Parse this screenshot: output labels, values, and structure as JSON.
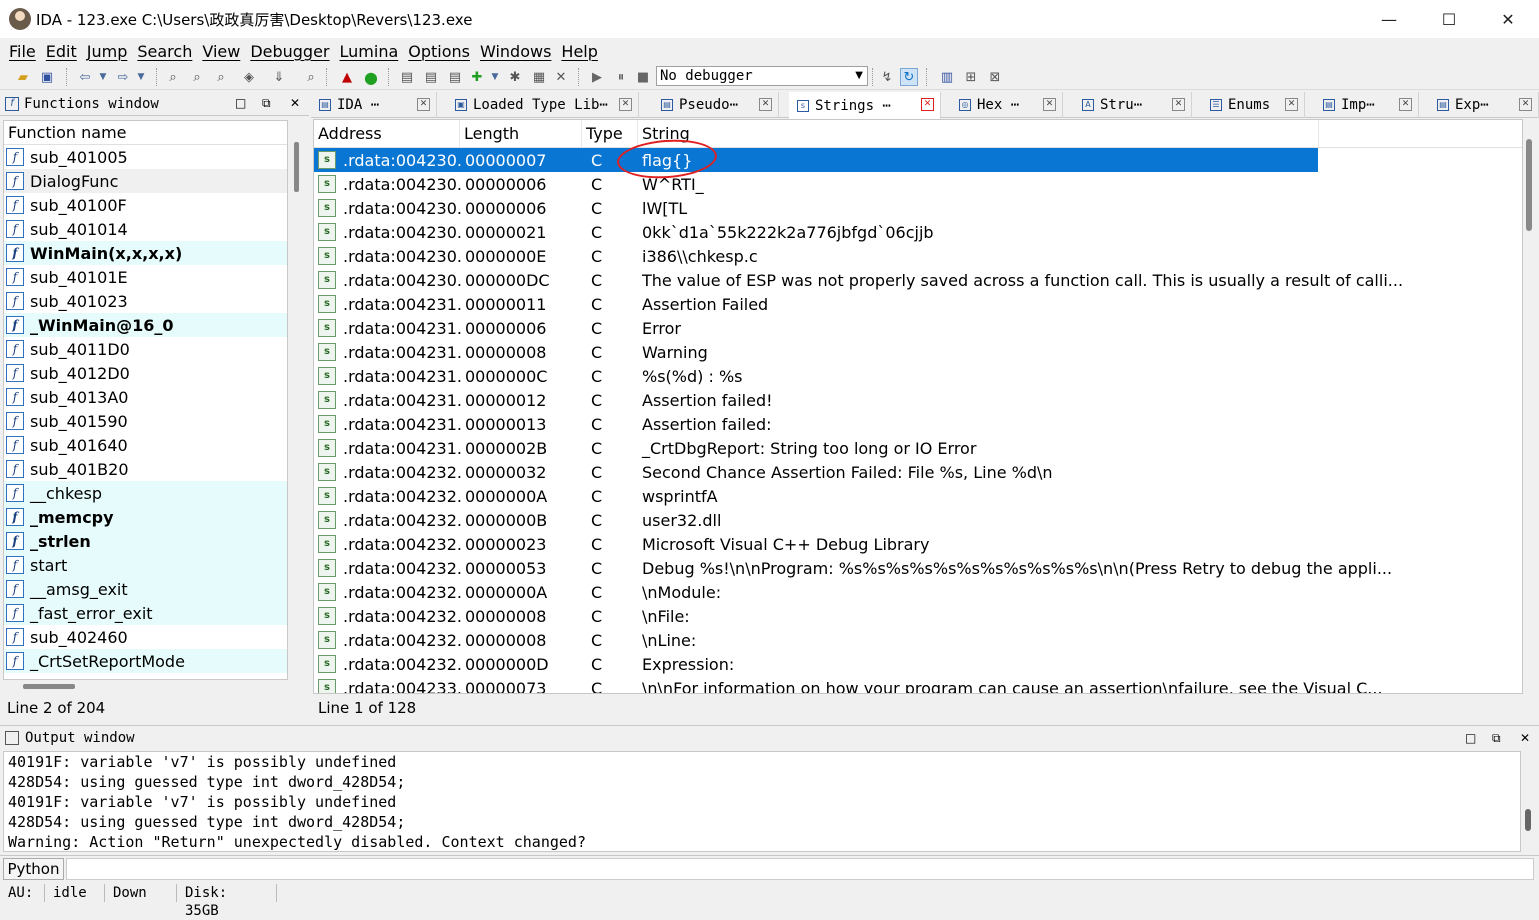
{
  "window": {
    "title": "IDA - 123.exe C:\\Users\\政政真厉害\\Desktop\\Revers\\123.exe",
    "minimize": "—",
    "maximize": "☐",
    "close": "✕"
  },
  "menu": [
    "File",
    "Edit",
    "Jump",
    "Search",
    "View",
    "Debugger",
    "Lumina",
    "Options",
    "Windows",
    "Help"
  ],
  "toolbar": {
    "debugger_select": "No debugger"
  },
  "functions_panel": {
    "title": "Functions window",
    "column": "Function name",
    "status": "Line 2 of 204",
    "items": [
      {
        "name": "sub_401005",
        "style": ""
      },
      {
        "name": "DialogFunc",
        "style": "sel"
      },
      {
        "name": "sub_40100F",
        "style": ""
      },
      {
        "name": "sub_401014",
        "style": ""
      },
      {
        "name": "WinMain(x,x,x,x)",
        "style": "lib bold"
      },
      {
        "name": "sub_40101E",
        "style": ""
      },
      {
        "name": "sub_401023",
        "style": ""
      },
      {
        "name": "_WinMain@16_0",
        "style": "lib bold"
      },
      {
        "name": "sub_4011D0",
        "style": ""
      },
      {
        "name": "sub_4012D0",
        "style": ""
      },
      {
        "name": "sub_4013A0",
        "style": ""
      },
      {
        "name": "sub_401590",
        "style": ""
      },
      {
        "name": "sub_401640",
        "style": ""
      },
      {
        "name": "sub_401B20",
        "style": ""
      },
      {
        "name": "__chkesp",
        "style": "lib"
      },
      {
        "name": "_memcpy",
        "style": "lib bold"
      },
      {
        "name": "_strlen",
        "style": "lib bold"
      },
      {
        "name": "start",
        "style": "lib"
      },
      {
        "name": "__amsg_exit",
        "style": "lib"
      },
      {
        "name": "_fast_error_exit",
        "style": "lib"
      },
      {
        "name": "sub_402460",
        "style": ""
      },
      {
        "name": "_CrtSetReportMode",
        "style": "lib"
      }
    ]
  },
  "tabs": [
    {
      "label": "IDA ⋯",
      "active": false
    },
    {
      "label": "Loaded Type Lib⋯",
      "active": false
    },
    {
      "label": "Pseudo⋯",
      "active": false
    },
    {
      "label": "Strings ⋯",
      "active": true
    },
    {
      "label": "Hex ⋯",
      "active": false
    },
    {
      "label": "Stru⋯",
      "active": false
    },
    {
      "label": "Enums",
      "active": false
    },
    {
      "label": "Imp⋯",
      "active": false
    },
    {
      "label": "Exp⋯",
      "active": false
    }
  ],
  "strings_view": {
    "columns": [
      "Address",
      "Length",
      "Type",
      "String"
    ],
    "status": "Line 1 of 128",
    "rows": [
      {
        "address": ".rdata:004230...",
        "length": "00000007",
        "type": "C",
        "string": "flag{}"
      },
      {
        "address": ".rdata:004230...",
        "length": "00000006",
        "type": "C",
        "string": "W^RTI_"
      },
      {
        "address": ".rdata:004230...",
        "length": "00000006",
        "type": "C",
        "string": "lW[TL"
      },
      {
        "address": ".rdata:004230...",
        "length": "00000021",
        "type": "C",
        "string": "0kk`d1a`55k222k2a776jbfgd`06cjjb"
      },
      {
        "address": ".rdata:004230...",
        "length": "0000000E",
        "type": "C",
        "string": "i386\\\\chkesp.c"
      },
      {
        "address": ".rdata:004230...",
        "length": "000000DC",
        "type": "C",
        "string": "The value of ESP was not properly saved across a function call.  This is usually a result of calli..."
      },
      {
        "address": ".rdata:004231...",
        "length": "00000011",
        "type": "C",
        "string": "Assertion Failed"
      },
      {
        "address": ".rdata:004231...",
        "length": "00000006",
        "type": "C",
        "string": "Error"
      },
      {
        "address": ".rdata:004231...",
        "length": "00000008",
        "type": "C",
        "string": "Warning"
      },
      {
        "address": ".rdata:004231...",
        "length": "0000000C",
        "type": "C",
        "string": "%s(%d) : %s"
      },
      {
        "address": ".rdata:004231...",
        "length": "00000012",
        "type": "C",
        "string": "Assertion failed!"
      },
      {
        "address": ".rdata:004231...",
        "length": "00000013",
        "type": "C",
        "string": "Assertion failed:"
      },
      {
        "address": ".rdata:004231...",
        "length": "0000002B",
        "type": "C",
        "string": "_CrtDbgReport: String too long or IO Error"
      },
      {
        "address": ".rdata:004232...",
        "length": "00000032",
        "type": "C",
        "string": "Second Chance Assertion Failed: File %s, Line %d\\n"
      },
      {
        "address": ".rdata:004232...",
        "length": "0000000A",
        "type": "C",
        "string": "wsprintfA"
      },
      {
        "address": ".rdata:004232...",
        "length": "0000000B",
        "type": "C",
        "string": "user32.dll"
      },
      {
        "address": ".rdata:004232...",
        "length": "00000023",
        "type": "C",
        "string": "Microsoft Visual C++ Debug Library"
      },
      {
        "address": ".rdata:004232...",
        "length": "00000053",
        "type": "C",
        "string": "Debug %s!\\n\\nProgram: %s%s%s%s%s%s%s%s%s%s%s\\n\\n(Press Retry to debug the appli..."
      },
      {
        "address": ".rdata:004232...",
        "length": "0000000A",
        "type": "C",
        "string": "\\nModule:"
      },
      {
        "address": ".rdata:004232...",
        "length": "00000008",
        "type": "C",
        "string": "\\nFile:"
      },
      {
        "address": ".rdata:004232...",
        "length": "00000008",
        "type": "C",
        "string": "\\nLine:"
      },
      {
        "address": ".rdata:004232...",
        "length": "0000000D",
        "type": "C",
        "string": "Expression:"
      },
      {
        "address": ".rdata:004233...",
        "length": "00000073",
        "type": "C",
        "string": "\\n\\nFor information on how your program can cause an assertion\\nfailure, see the Visual C..."
      }
    ]
  },
  "output_panel": {
    "title": "Output window",
    "lines": [
      "40191F: variable 'v7' is possibly undefined",
      "428D54: using guessed type int dword_428D54;",
      "40191F: variable 'v7' is possibly undefined",
      "428D54: using guessed type int dword_428D54;",
      "Warning: Action \"Return\" unexpectedly disabled. Context changed?"
    ]
  },
  "python_button": "Python",
  "statusbar": {
    "au": "AU:",
    "state": "idle",
    "direction": "Down",
    "disk": "Disk: 35GB"
  },
  "colors": {
    "selection": "#0a76d4",
    "library_function_bg": "#e6fbfb",
    "annotation": "#e02020"
  }
}
